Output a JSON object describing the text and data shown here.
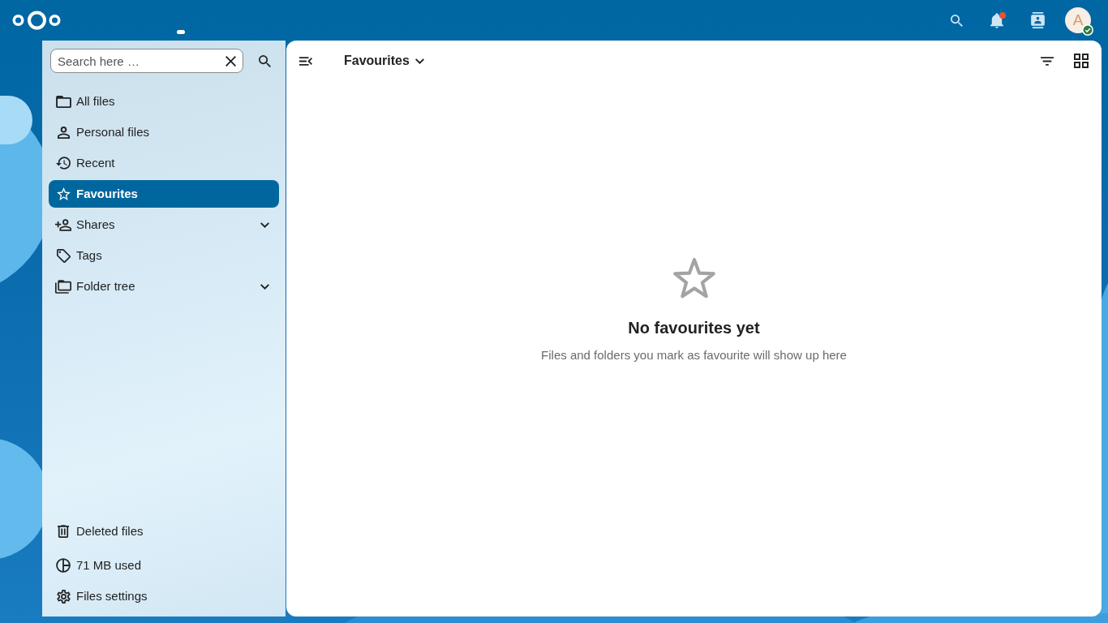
{
  "header": {
    "notifications": {
      "unread": true
    },
    "user": {
      "initial": "A",
      "online": true
    }
  },
  "sidebar": {
    "search": {
      "placeholder": "Search here …"
    },
    "nav": [
      {
        "label": "All files",
        "selected": false,
        "expandable": false
      },
      {
        "label": "Personal files",
        "selected": false,
        "expandable": false
      },
      {
        "label": "Recent",
        "selected": false,
        "expandable": false
      },
      {
        "label": "Favourites",
        "selected": true,
        "expandable": false
      },
      {
        "label": "Shares",
        "selected": false,
        "expandable": true
      },
      {
        "label": "Tags",
        "selected": false,
        "expandable": false
      },
      {
        "label": "Folder tree",
        "selected": false,
        "expandable": true
      }
    ],
    "footer": [
      {
        "label": "Deleted files"
      },
      {
        "label": "71 MB used"
      },
      {
        "label": "Files settings"
      }
    ]
  },
  "main": {
    "title": "Favourites",
    "empty_state": {
      "title": "No favourites yet",
      "description": "Files and folders you mark as favourite will show up here"
    }
  }
}
